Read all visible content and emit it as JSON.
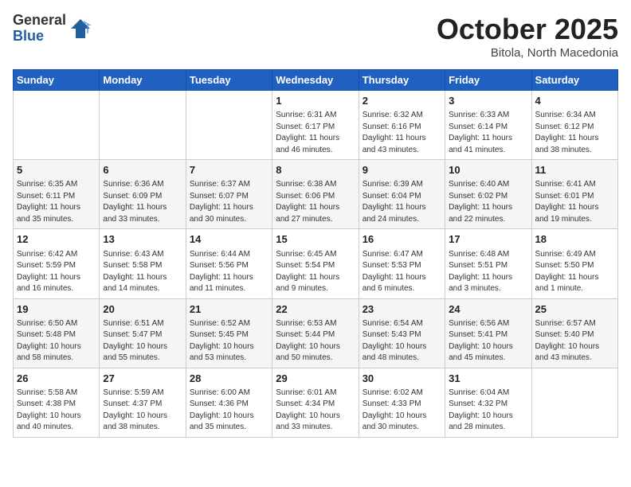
{
  "logo": {
    "general": "General",
    "blue": "Blue"
  },
  "header": {
    "month": "October 2025",
    "location": "Bitola, North Macedonia"
  },
  "weekdays": [
    "Sunday",
    "Monday",
    "Tuesday",
    "Wednesday",
    "Thursday",
    "Friday",
    "Saturday"
  ],
  "weeks": [
    [
      {
        "day": "",
        "info": ""
      },
      {
        "day": "",
        "info": ""
      },
      {
        "day": "",
        "info": ""
      },
      {
        "day": "1",
        "info": "Sunrise: 6:31 AM\nSunset: 6:17 PM\nDaylight: 11 hours\nand 46 minutes."
      },
      {
        "day": "2",
        "info": "Sunrise: 6:32 AM\nSunset: 6:16 PM\nDaylight: 11 hours\nand 43 minutes."
      },
      {
        "day": "3",
        "info": "Sunrise: 6:33 AM\nSunset: 6:14 PM\nDaylight: 11 hours\nand 41 minutes."
      },
      {
        "day": "4",
        "info": "Sunrise: 6:34 AM\nSunset: 6:12 PM\nDaylight: 11 hours\nand 38 minutes."
      }
    ],
    [
      {
        "day": "5",
        "info": "Sunrise: 6:35 AM\nSunset: 6:11 PM\nDaylight: 11 hours\nand 35 minutes."
      },
      {
        "day": "6",
        "info": "Sunrise: 6:36 AM\nSunset: 6:09 PM\nDaylight: 11 hours\nand 33 minutes."
      },
      {
        "day": "7",
        "info": "Sunrise: 6:37 AM\nSunset: 6:07 PM\nDaylight: 11 hours\nand 30 minutes."
      },
      {
        "day": "8",
        "info": "Sunrise: 6:38 AM\nSunset: 6:06 PM\nDaylight: 11 hours\nand 27 minutes."
      },
      {
        "day": "9",
        "info": "Sunrise: 6:39 AM\nSunset: 6:04 PM\nDaylight: 11 hours\nand 24 minutes."
      },
      {
        "day": "10",
        "info": "Sunrise: 6:40 AM\nSunset: 6:02 PM\nDaylight: 11 hours\nand 22 minutes."
      },
      {
        "day": "11",
        "info": "Sunrise: 6:41 AM\nSunset: 6:01 PM\nDaylight: 11 hours\nand 19 minutes."
      }
    ],
    [
      {
        "day": "12",
        "info": "Sunrise: 6:42 AM\nSunset: 5:59 PM\nDaylight: 11 hours\nand 16 minutes."
      },
      {
        "day": "13",
        "info": "Sunrise: 6:43 AM\nSunset: 5:58 PM\nDaylight: 11 hours\nand 14 minutes."
      },
      {
        "day": "14",
        "info": "Sunrise: 6:44 AM\nSunset: 5:56 PM\nDaylight: 11 hours\nand 11 minutes."
      },
      {
        "day": "15",
        "info": "Sunrise: 6:45 AM\nSunset: 5:54 PM\nDaylight: 11 hours\nand 9 minutes."
      },
      {
        "day": "16",
        "info": "Sunrise: 6:47 AM\nSunset: 5:53 PM\nDaylight: 11 hours\nand 6 minutes."
      },
      {
        "day": "17",
        "info": "Sunrise: 6:48 AM\nSunset: 5:51 PM\nDaylight: 11 hours\nand 3 minutes."
      },
      {
        "day": "18",
        "info": "Sunrise: 6:49 AM\nSunset: 5:50 PM\nDaylight: 11 hours\nand 1 minute."
      }
    ],
    [
      {
        "day": "19",
        "info": "Sunrise: 6:50 AM\nSunset: 5:48 PM\nDaylight: 10 hours\nand 58 minutes."
      },
      {
        "day": "20",
        "info": "Sunrise: 6:51 AM\nSunset: 5:47 PM\nDaylight: 10 hours\nand 55 minutes."
      },
      {
        "day": "21",
        "info": "Sunrise: 6:52 AM\nSunset: 5:45 PM\nDaylight: 10 hours\nand 53 minutes."
      },
      {
        "day": "22",
        "info": "Sunrise: 6:53 AM\nSunset: 5:44 PM\nDaylight: 10 hours\nand 50 minutes."
      },
      {
        "day": "23",
        "info": "Sunrise: 6:54 AM\nSunset: 5:43 PM\nDaylight: 10 hours\nand 48 minutes."
      },
      {
        "day": "24",
        "info": "Sunrise: 6:56 AM\nSunset: 5:41 PM\nDaylight: 10 hours\nand 45 minutes."
      },
      {
        "day": "25",
        "info": "Sunrise: 6:57 AM\nSunset: 5:40 PM\nDaylight: 10 hours\nand 43 minutes."
      }
    ],
    [
      {
        "day": "26",
        "info": "Sunrise: 5:58 AM\nSunset: 4:38 PM\nDaylight: 10 hours\nand 40 minutes."
      },
      {
        "day": "27",
        "info": "Sunrise: 5:59 AM\nSunset: 4:37 PM\nDaylight: 10 hours\nand 38 minutes."
      },
      {
        "day": "28",
        "info": "Sunrise: 6:00 AM\nSunset: 4:36 PM\nDaylight: 10 hours\nand 35 minutes."
      },
      {
        "day": "29",
        "info": "Sunrise: 6:01 AM\nSunset: 4:34 PM\nDaylight: 10 hours\nand 33 minutes."
      },
      {
        "day": "30",
        "info": "Sunrise: 6:02 AM\nSunset: 4:33 PM\nDaylight: 10 hours\nand 30 minutes."
      },
      {
        "day": "31",
        "info": "Sunrise: 6:04 AM\nSunset: 4:32 PM\nDaylight: 10 hours\nand 28 minutes."
      },
      {
        "day": "",
        "info": ""
      }
    ]
  ]
}
